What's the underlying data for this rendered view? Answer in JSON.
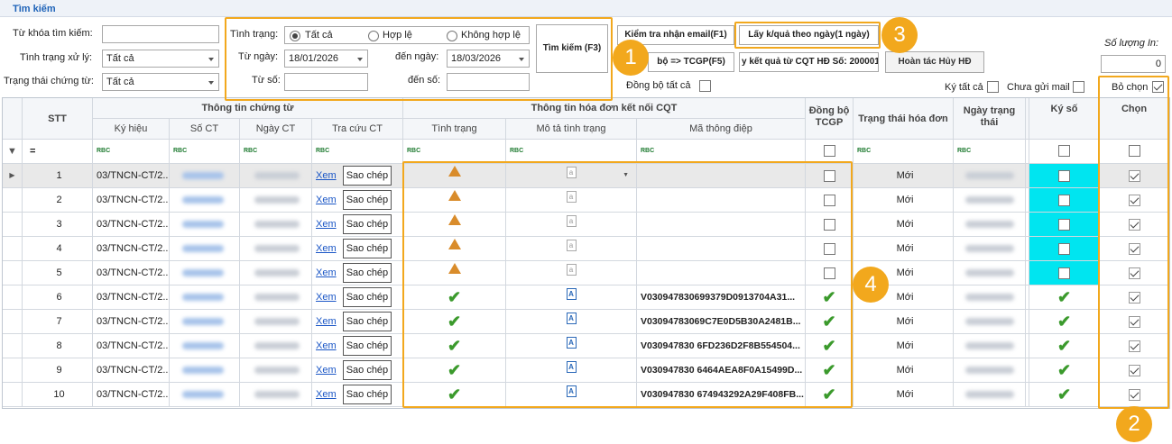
{
  "panel": {
    "title": "Tìm kiếm"
  },
  "search": {
    "keyword_label": "Từ khóa tìm kiếm:",
    "keyword_value": "",
    "processing_label": "Tình trạng xử lý:",
    "processing_value": "Tất cả",
    "doc_status_label": "Trạng thái chứng từ:",
    "doc_status_value": "Tất cả",
    "status_label": "Tình trạng:",
    "radio_all": "Tất cả",
    "radio_valid": "Hợp lệ",
    "radio_invalid": "Không hợp lệ",
    "from_date_label": "Từ ngày:",
    "from_date_value": "18/01/2026",
    "to_date_label": "đến ngày:",
    "to_date_value": "18/03/2026",
    "from_no_label": "Từ số:",
    "from_no_value": "",
    "to_no_label": "đến số:",
    "to_no_value": "",
    "search_button": "Tìm kiếm (F3)"
  },
  "actions": {
    "check_email": "Kiểm tra nhận email(F1)",
    "get_results_by_day": "Lấy k/quả theo ngày(1 ngày)",
    "sync_tcgp": "bộ => TCGP(F5)",
    "result_from_cqt": "y kết quả từ CQT HĐ Số: 20000123",
    "undo_cancel": "Hoàn tác Hủy HĐ",
    "sync_all_label": "Đồng bộ tất cả",
    "quantity_label": "Số lượng In:",
    "quantity_value": "0",
    "sign_all_label": "Ký tất cả",
    "not_sent_mail_label": "Chưa gửi mail",
    "deselect_label": "Bỏ chọn"
  },
  "badges": [
    "1",
    "2",
    "3",
    "4"
  ],
  "grid": {
    "group_doc": "Thông tin chứng từ",
    "group_invoice": "Thông tin hóa đơn kết nối CQT",
    "headers": {
      "stt": "STT",
      "ky_hieu": "Ký hiệu",
      "so_ct": "Số CT",
      "ngay_ct": "Ngày CT",
      "tra_cuu": "Tra cứu CT",
      "tinh_trang": "Tình trạng",
      "mo_ta": "Mô tả tình trạng",
      "ma_thong_diep": "Mã thông điệp",
      "dong_bo": "Đồng bộ TCGP",
      "trang_thai_hd": "Trạng thái hóa đơn",
      "ngay_trang_thai": "Ngày trạng thái",
      "ky_so": "Ký số",
      "chon": "Chọn"
    },
    "filter_eq": "=",
    "filter_rbc": "RBC",
    "link_text": "Xem",
    "copy_text": "Sao chép",
    "rows": [
      {
        "stt": "1",
        "ky_hieu": "03/TNCN-CT/2...",
        "status": "warning",
        "ma": "",
        "dong_bo": false,
        "trang_thai": "Mới",
        "ky_so": "box"
      },
      {
        "stt": "2",
        "ky_hieu": "03/TNCN-CT/2...",
        "status": "warning",
        "ma": "",
        "dong_bo": false,
        "trang_thai": "Mới",
        "ky_so": "box"
      },
      {
        "stt": "3",
        "ky_hieu": "03/TNCN-CT/2...",
        "status": "warning",
        "ma": "",
        "dong_bo": false,
        "trang_thai": "Mới",
        "ky_so": "box"
      },
      {
        "stt": "4",
        "ky_hieu": "03/TNCN-CT/2...",
        "status": "warning",
        "ma": "",
        "dong_bo": false,
        "trang_thai": "Mới",
        "ky_so": "box"
      },
      {
        "stt": "5",
        "ky_hieu": "03/TNCN-CT/2...",
        "status": "warning",
        "ma": "",
        "dong_bo": false,
        "trang_thai": "Mới",
        "ky_so": "box"
      },
      {
        "stt": "6",
        "ky_hieu": "03/TNCN-CT/2...",
        "status": "ok",
        "ma": "V030947830699379D0913704A31...",
        "dong_bo": true,
        "trang_thai": "Mới",
        "ky_so": "tick"
      },
      {
        "stt": "7",
        "ky_hieu": "03/TNCN-CT/2...",
        "status": "ok",
        "ma": "V03094783069C7E0D5B30A2481B...",
        "dong_bo": true,
        "trang_thai": "Mới",
        "ky_so": "tick"
      },
      {
        "stt": "8",
        "ky_hieu": "03/TNCN-CT/2...",
        "status": "ok",
        "ma": "V030947830 6FD236D2F8B554504...",
        "dong_bo": true,
        "trang_thai": "Mới",
        "ky_so": "tick"
      },
      {
        "stt": "9",
        "ky_hieu": "03/TNCN-CT/2...",
        "status": "ok",
        "ma": "V030947830 6464AEA8F0A15499D...",
        "dong_bo": true,
        "trang_thai": "Mới",
        "ky_so": "tick"
      },
      {
        "stt": "10",
        "ky_hieu": "03/TNCN-CT/2...",
        "status": "ok",
        "ma": "V030947830 674943292A29F408FB...",
        "dong_bo": true,
        "trang_thai": "Mới",
        "ky_so": "tick"
      }
    ]
  },
  "colors": {
    "highlight": "#f2a81d",
    "cyan": "#00e5f0",
    "ok_green": "#3b9a2c",
    "warn": "#d98c2b",
    "link": "#1a56c6"
  }
}
